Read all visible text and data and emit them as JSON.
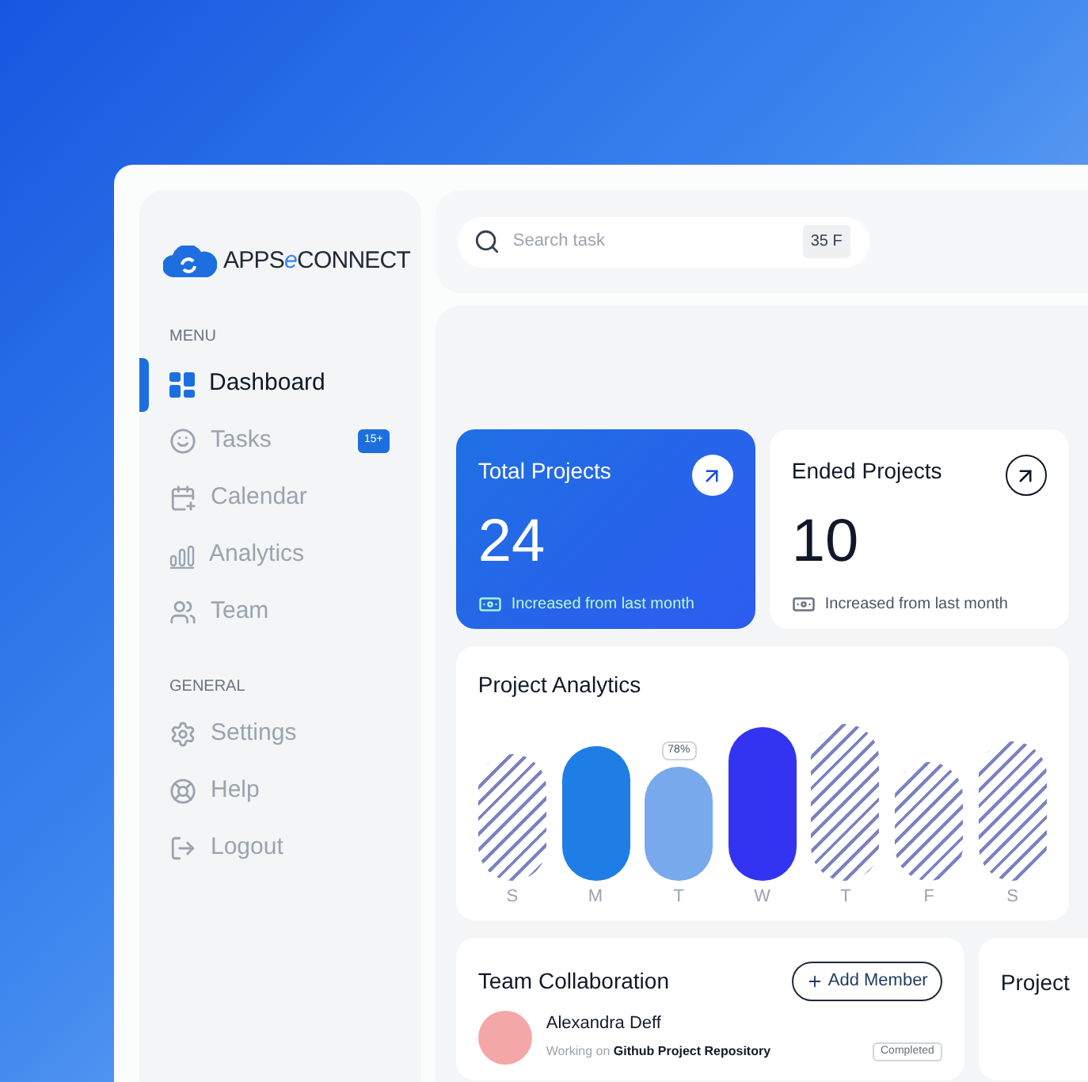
{
  "logo": {
    "parts": [
      {
        "text": "APPS",
        "accent": false
      },
      {
        "text": "e",
        "accent": true
      },
      {
        "text": "CONNECT",
        "accent": false
      }
    ]
  },
  "sidebar": {
    "sections": [
      {
        "title": "MENU",
        "items": [
          {
            "label": "Dashboard",
            "selected": true
          },
          {
            "label": "Tasks",
            "selected": false,
            "badge": "15+"
          },
          {
            "label": "Calendar",
            "selected": false
          },
          {
            "label": "Analytics",
            "selected": false
          },
          {
            "label": "Team",
            "selected": false
          }
        ]
      },
      {
        "title": "GENERAL",
        "items": [
          {
            "label": "Settings",
            "selected": false
          },
          {
            "label": "Help",
            "selected": false
          },
          {
            "label": "Logout",
            "selected": false
          }
        ]
      }
    ]
  },
  "search": {
    "placeholder": "Search task",
    "shortcut": "35 F"
  },
  "stats": [
    {
      "title": "Total Projects",
      "value": "24",
      "note": "Increased from last month",
      "highlighted": true
    },
    {
      "title": "Ended Projects",
      "value": "10",
      "note": "Increased from last month",
      "highlighted": false
    }
  ],
  "analytics": {
    "title": "Project Analytics",
    "bars": [
      {
        "day": "S",
        "kind": "hatched"
      },
      {
        "day": "M",
        "kind": "solid"
      },
      {
        "day": "T",
        "kind": "light",
        "tooltip": "78%"
      },
      {
        "day": "W",
        "kind": "dark"
      },
      {
        "day": "T",
        "kind": "hatched"
      },
      {
        "day": "F",
        "kind": "hatched"
      },
      {
        "day": "S",
        "kind": "hatched"
      }
    ]
  },
  "team": {
    "title": "Team Collaboration",
    "button": "Add Member",
    "members": [
      {
        "name": "Alexandra Deff",
        "task": "Working on **Github Project Repository**",
        "status": "Completed"
      }
    ]
  },
  "progress": {
    "title": "Project"
  }
}
